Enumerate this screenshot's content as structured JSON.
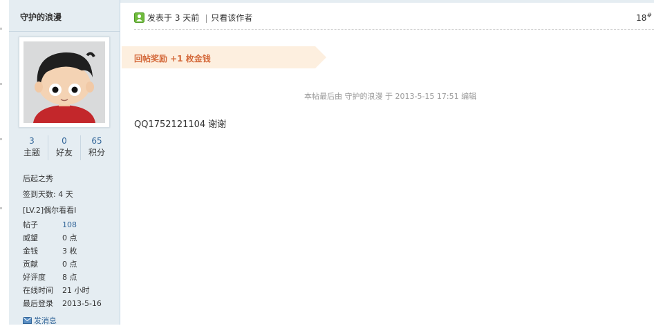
{
  "author": {
    "name": "守护的浪漫",
    "stats": [
      {
        "value": "3",
        "label": "主题"
      },
      {
        "value": "0",
        "label": "好友"
      },
      {
        "value": "65",
        "label": "积分"
      }
    ],
    "group": "后起之秀",
    "signin": "签到天数: 4 天",
    "level": "[LV.2]偶尔看看I",
    "props": [
      {
        "key": "帖子",
        "value": "108"
      },
      {
        "key": "威望",
        "value": "0 点"
      },
      {
        "key": "金钱",
        "value": "3 枚"
      },
      {
        "key": "贡献",
        "value": "0 点"
      },
      {
        "key": "好评度",
        "value": "8 点"
      },
      {
        "key": "在线时间",
        "value": "21 小时"
      },
      {
        "key": "最后登录",
        "value": "2013-5-16"
      }
    ],
    "send_message": "发消息"
  },
  "post": {
    "posted_at": "发表于 3 天前",
    "only_author": "只看该作者",
    "floor": "18",
    "floor_mark": "#",
    "reward": "回帖奖励 +1 枚金钱",
    "edit_note": "本帖最后由 守护的浪漫 于 2013-5-15 17:51 编辑",
    "content": "QQ1752121104   谢谢"
  },
  "colors": {
    "sidebar_bg": "#e5edf2",
    "link": "#336699",
    "reward_text": "#d4693a",
    "reward_bg": "#fdefdf"
  }
}
